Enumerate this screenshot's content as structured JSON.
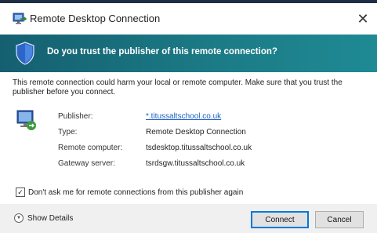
{
  "window": {
    "title": "Remote Desktop Connection",
    "close_glyph": "✕"
  },
  "banner": {
    "heading": "Do you trust the publisher of this remote connection?",
    "color": "#1b7a85"
  },
  "warning_text": "This remote connection could harm your local or remote computer. Make sure that you trust the publisher before you connect.",
  "details": [
    {
      "label": "Publisher:",
      "value": "*.titussaltschool.co.uk",
      "is_link": true
    },
    {
      "label": "Type:",
      "value": "Remote Desktop Connection",
      "is_link": false
    },
    {
      "label": "Remote computer:",
      "value": "tsdesktop.titussaltschool.co.uk",
      "is_link": false
    },
    {
      "label": "Gateway server:",
      "value": "tsrdsgw.titussaltschool.co.uk",
      "is_link": false
    }
  ],
  "dont_ask": {
    "label": "Don't ask me for remote connections from this publisher again",
    "checked": true,
    "check_glyph": "✓"
  },
  "footer": {
    "show_details_label": "Show Details",
    "connect_label": "Connect",
    "cancel_label": "Cancel"
  },
  "icons": {
    "app": "remote-desktop-icon",
    "banner": "shield-icon",
    "details": "remote-computer-icon",
    "expand": "chevron-down-icon"
  }
}
